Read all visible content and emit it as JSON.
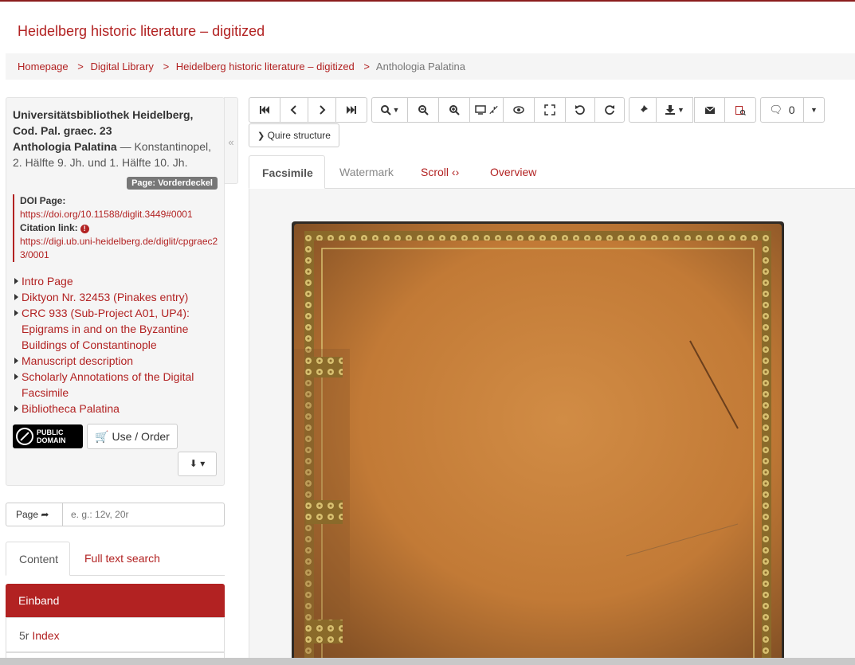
{
  "site_title": "Heidelberg historic literature – digitized",
  "breadcrumb": {
    "items": [
      "Homepage",
      "Digital Library",
      "Heidelberg historic literature – digitized"
    ],
    "current": "Anthologia Palatina",
    "separator": ">"
  },
  "meta": {
    "library": "Universitätsbibliothek Heidelberg,",
    "shelfmark": "Cod. Pal. graec. 23",
    "title": "Anthologia Palatina",
    "dash": " — ",
    "place_date": "Konstantinopel, 2. Hälfte 9. Jh. und 1. Hälfte 10. Jh.",
    "page_badge": "Page: Vorderdeckel"
  },
  "doi": {
    "doi_label": "DOI Page:",
    "doi_url": "https://doi.org/10.11588/diglit.3449#0001",
    "citation_label": "Citation link:",
    "citation_url": "https://digi.ub.uni-heidelberg.de/diglit/cpgraec23/0001"
  },
  "links": [
    "Intro Page",
    "Diktyon Nr. 32453 (Pinakes entry)",
    "CRC 933 (Sub-Project A01, UP4): Epigrams in and on the Byzantine Buildings of Constantinople",
    "Manuscript description",
    "Scholarly Annotations of the Digital Facsimile",
    "Bibliotheca Palatina"
  ],
  "license": {
    "line1": "PUBLIC",
    "line2": "DOMAIN"
  },
  "use_order": "Use / Order",
  "page_input": {
    "label": "Page",
    "placeholder": "e. g.: 12v, 20r"
  },
  "left_tabs": [
    "Content",
    "Full text search"
  ],
  "toc": {
    "active": "Einband",
    "item_folio": "5r",
    "item_label": "Index"
  },
  "toolbar": {
    "comments_count": "0",
    "quire_label": "Quire structure"
  },
  "view_tabs": [
    "Facsimile",
    "Watermark",
    "Scroll",
    "Overview"
  ],
  "colors": {
    "accent": "#b22222",
    "book_leather": "#c9823e"
  }
}
